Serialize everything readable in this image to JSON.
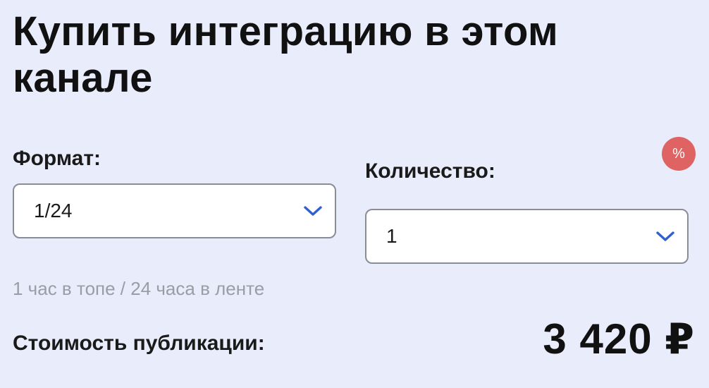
{
  "title": "Купить интеграцию в этом канале",
  "format": {
    "label": "Формат:",
    "selected": "1/24",
    "description": "1 час в топе / 24 часа в ленте"
  },
  "quantity": {
    "label": "Количество:",
    "selected": "1"
  },
  "discount_badge": "%",
  "price": {
    "label": "Стоимость публикации:",
    "value": "3 420 ₽"
  },
  "colors": {
    "background": "#e9ecfa",
    "chevron": "#2f5fd0",
    "badge": "#e06363",
    "muted_text": "#9a9ca6"
  }
}
